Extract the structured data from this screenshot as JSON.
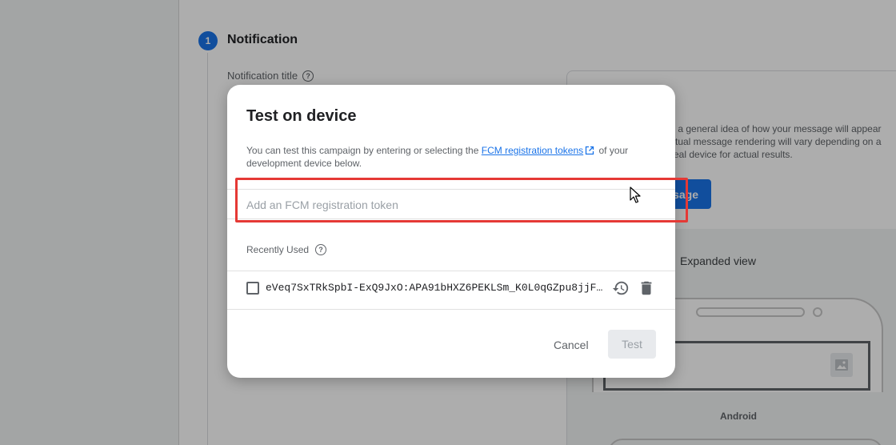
{
  "background": {
    "step_number": "1",
    "step_title": "Notification",
    "field_label": "Notification title",
    "preview_text": "s a general idea of how your message will appear ctual message rendering will vary depending on a real device for actual results.",
    "preview_button": "sage",
    "expanded_view": "Expanded view",
    "platform_label": "Android"
  },
  "dialog": {
    "title": "Test on device",
    "description_before": "You can test this campaign by entering or selecting the ",
    "description_link": "FCM registration tokens",
    "description_after": " of your development device below.",
    "token_input": {
      "placeholder": "Add an FCM registration token",
      "value": ""
    },
    "recent_label": "Recently Used",
    "recent_items": [
      {
        "token": "eVeq7SxTRkSpbI-ExQ9JxO:APA91bHXZ6PEKLSm_K0L0qGZpu8jjF9…",
        "checked": false
      }
    ],
    "cancel_label": "Cancel",
    "test_label": "Test"
  },
  "colors": {
    "accent": "#1a73e8",
    "highlight": "#e53935"
  }
}
